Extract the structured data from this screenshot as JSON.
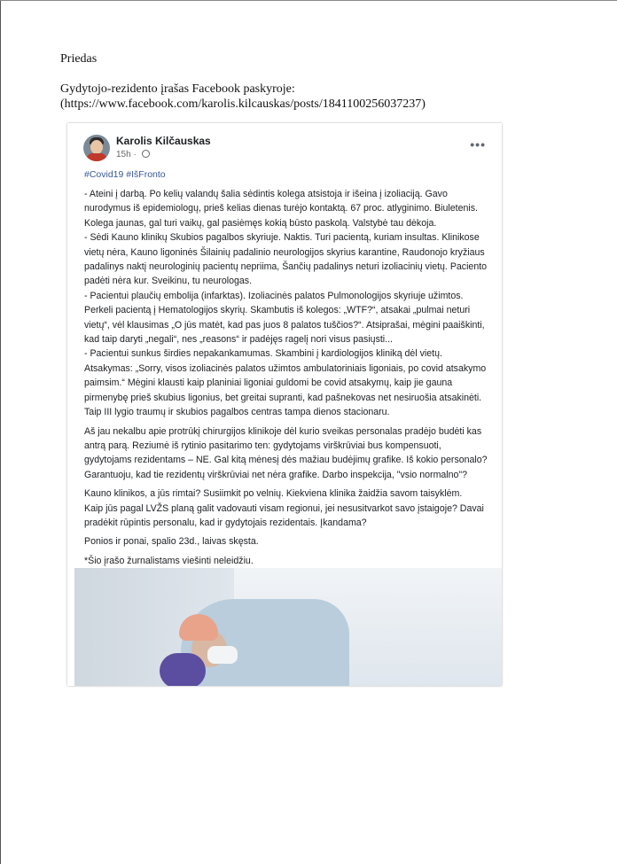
{
  "document": {
    "heading": "Priedas",
    "caption_line1": "Gydytojo-rezidento įrašas Facebook paskyroje:",
    "caption_line2": "(https://www.facebook.com/karolis.kilcauskas/posts/1841100256037237)"
  },
  "post": {
    "author": "Karolis Kilčauskas",
    "time": "15h",
    "more_icon": "more-icon",
    "hashtags": "#Covid19 #IšFronto",
    "paragraph1": [
      "- Ateini į darbą. Po kelių valandų šalia sėdintis kolega atsistoja ir išeina į izoliaciją. Gavo",
      "nurodymus iš epidemiologų, prieš kelias dienas turėjo kontaktą. 67 proc. atlyginimo. Biuletenis.",
      "Kolega jaunas, gal turi vaikų, gal pasiėmęs kokią būsto paskolą. Valstybė tau dėkoja.",
      "- Sėdi Kauno klinikų Skubios pagalbos skyriuje. Naktis. Turi pacientą, kuriam insultas. Klinikose",
      "vietų nėra, Kauno ligoninės Šilainių padalinio neurologijos skyrius karantine, Raudonojo kryžiaus",
      "padalinys naktį neurologinių pacientų nepriima, Šančių padalinys neturi izoliacinių vietų. Paciento",
      "padėti nėra kur. Sveikinu, tu neurologas.",
      "- Pacientui plaučių embolija (infarktas). Izoliacinės palatos Pulmonologijos skyriuje užimtos.",
      "Perkeli pacientą į Hematologijos skyrių. Skambutis iš kolegos: „WTF?“, atsakai „pulmai neturi",
      "vietų“, vėl klausimas „O jūs matėt, kad pas juos 8 palatos tuščios?“. Atsiprašai, mėgini paaiškinti,",
      "kad taip daryti „negali“, nes „reasons“ ir padėjęs ragelį nori visus pasiųsti...",
      "- Pacientui sunkus širdies nepakankamumas. Skambini į kardiologijos kliniką dėl vietų.",
      "Atsakymas: „Sorry, visos izoliacinės palatos užimtos ambulatoriniais ligoniais, po covid atsakymo",
      "paimsim.“ Mėgini klausti kaip planiniai ligoniai guldomi be covid atsakymų, kaip jie gauna",
      "pirmenybę prieš skubius ligonius, bet greitai supranti, kad pašnekovas net nesiruošia atsakinėti.",
      "Taip III lygio traumų ir skubios pagalbos centras tampa dienos stacionaru."
    ],
    "paragraph2": [
      "Aš jau nekalbu apie protrūkį chirurgijos klinikoje dėl kurio sveikas personalas pradėjo budėti kas",
      "antrą parą. Reziumė iš rytinio pasitarimo ten: gydytojams virškrūviai bus kompensuoti,",
      "gydytojams rezidentams – NE. Gal kitą mėnesį dės mažiau budėjimų grafike. Iš kokio personalo?",
      "Garantuoju, kad tie rezidentų virškrūviai net nėra grafike. Darbo inspekcija, \"vsio normalno\"?"
    ],
    "paragraph3": [
      "Kauno klinikos, a jūs rimtai? Susiimkit po velnių. Kiekviena klinika žaidžia savom taisyklėm.",
      "Kaip jūs pagal LVŽS planą galit vadovauti visam regionui, jei nesusitvarkot savo įstaigoje? Davai",
      "pradėkit rūpintis personalu, kad ir gydytojais rezidentais. Įkandama?"
    ],
    "paragraph4": "Ponios ir ponai, spalio 23d., laivas skęsta.",
    "paragraph5": "*Šio įrašo žurnalistams viešinti neleidžiu."
  }
}
